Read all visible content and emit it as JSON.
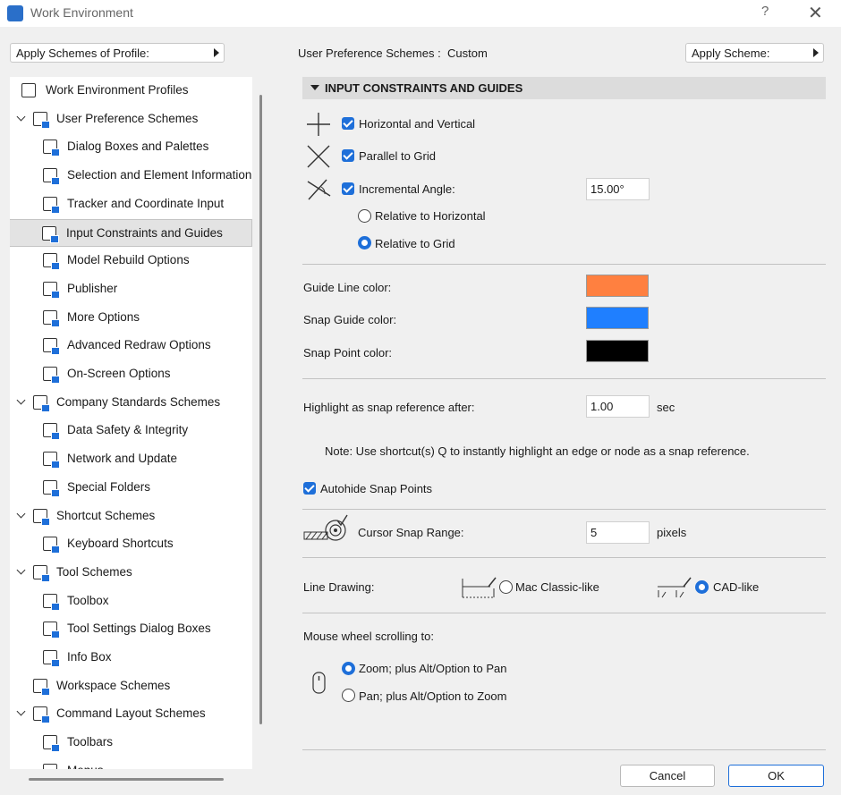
{
  "window": {
    "title": "Work Environment",
    "help": "?",
    "close": "✕"
  },
  "left": {
    "apply_profile_label": "Apply Schemes of Profile:",
    "tree": [
      {
        "label": "Work Environment Profiles",
        "level": 0,
        "expander": false,
        "icon": "profiles-icon"
      },
      {
        "label": "User Preference Schemes",
        "level": 1,
        "expander": true,
        "icon": "user-prefs-icon"
      },
      {
        "label": "Dialog Boxes and Palettes",
        "level": 2,
        "expander": false,
        "icon": "dialog-boxes-icon"
      },
      {
        "label": "Selection and Element Information",
        "level": 2,
        "expander": false,
        "icon": "selection-info-icon"
      },
      {
        "label": "Tracker and Coordinate Input",
        "level": 2,
        "expander": false,
        "icon": "tracker-icon"
      },
      {
        "label": "Input Constraints and Guides",
        "level": 2,
        "expander": false,
        "icon": "input-constraints-icon",
        "selected": true
      },
      {
        "label": "Model Rebuild Options",
        "level": 2,
        "expander": false,
        "icon": "model-rebuild-icon"
      },
      {
        "label": "Publisher",
        "level": 2,
        "expander": false,
        "icon": "publisher-icon"
      },
      {
        "label": "More Options",
        "level": 2,
        "expander": false,
        "icon": "more-options-icon"
      },
      {
        "label": "Advanced Redraw Options",
        "level": 2,
        "expander": false,
        "icon": "redraw-icon"
      },
      {
        "label": "On-Screen Options",
        "level": 2,
        "expander": false,
        "icon": "on-screen-icon"
      },
      {
        "label": "Company Standards Schemes",
        "level": 1,
        "expander": true,
        "icon": "company-standards-icon"
      },
      {
        "label": "Data Safety & Integrity",
        "level": 2,
        "expander": false,
        "icon": "data-safety-icon"
      },
      {
        "label": "Network and Update",
        "level": 2,
        "expander": false,
        "icon": "globe-icon"
      },
      {
        "label": "Special Folders",
        "level": 2,
        "expander": false,
        "icon": "folder-icon"
      },
      {
        "label": "Shortcut Schemes",
        "level": 1,
        "expander": true,
        "icon": "shortcut-schemes-icon"
      },
      {
        "label": "Keyboard Shortcuts",
        "level": 2,
        "expander": false,
        "icon": "keyboard-shortcut-icon"
      },
      {
        "label": "Tool Schemes",
        "level": 1,
        "expander": true,
        "icon": "tool-schemes-icon"
      },
      {
        "label": "Toolbox",
        "level": 2,
        "expander": false,
        "icon": "toolbox-icon"
      },
      {
        "label": "Tool Settings Dialog Boxes",
        "level": 2,
        "expander": false,
        "icon": "tool-settings-icon"
      },
      {
        "label": "Info Box",
        "level": 2,
        "expander": false,
        "icon": "info-box-icon"
      },
      {
        "label": "Workspace Schemes",
        "level": 1,
        "expander": false,
        "icon": "workspace-icon"
      },
      {
        "label": "Command Layout Schemes",
        "level": 1,
        "expander": true,
        "icon": "command-layout-icon"
      },
      {
        "label": "Toolbars",
        "level": 2,
        "expander": false,
        "icon": "toolbars-icon"
      },
      {
        "label": "Menus",
        "level": 2,
        "expander": false,
        "icon": "menus-icon"
      }
    ]
  },
  "right": {
    "scheme_label": "User Preference Schemes :",
    "scheme_value": "Custom",
    "apply_scheme_label": "Apply Scheme:",
    "section_title": "INPUT CONSTRAINTS AND GUIDES",
    "constraints": {
      "horizontal_vertical": {
        "label": "Horizontal and Vertical",
        "checked": true
      },
      "parallel_grid": {
        "label": "Parallel to Grid",
        "checked": true
      },
      "incremental_angle": {
        "label": "Incremental Angle:",
        "checked": true,
        "value": "15.00°"
      },
      "relative_horizontal": {
        "label": "Relative to Horizontal",
        "selected": false
      },
      "relative_grid": {
        "label": "Relative to Grid",
        "selected": true
      }
    },
    "colors": {
      "guide_line": {
        "label": "Guide Line color:",
        "color": "#ff8040"
      },
      "snap_guide": {
        "label": "Snap Guide color:",
        "color": "#1f7fff"
      },
      "snap_point": {
        "label": "Snap Point color:",
        "color": "#000000"
      }
    },
    "highlight": {
      "label": "Highlight as snap reference after:",
      "value": "1.00",
      "unit": "sec"
    },
    "note": "Note: Use shortcut(s) Q to instantly highlight an edge or node as a snap reference.",
    "autohide": {
      "label": "Autohide Snap Points",
      "checked": true
    },
    "cursor_snap": {
      "label": "Cursor Snap Range:",
      "value": "5",
      "unit": "pixels"
    },
    "line_drawing": {
      "label": "Line Drawing:",
      "mac_classic": "Mac Classic-like",
      "cad_like": "CAD-like",
      "selected": "cad_like"
    },
    "mouse_wheel": {
      "label": "Mouse wheel scrolling to:",
      "zoom": "Zoom; plus Alt/Option to Pan",
      "pan": "Pan; plus Alt/Option to Zoom",
      "selected": "zoom"
    },
    "cancel": "Cancel",
    "ok": "OK"
  }
}
